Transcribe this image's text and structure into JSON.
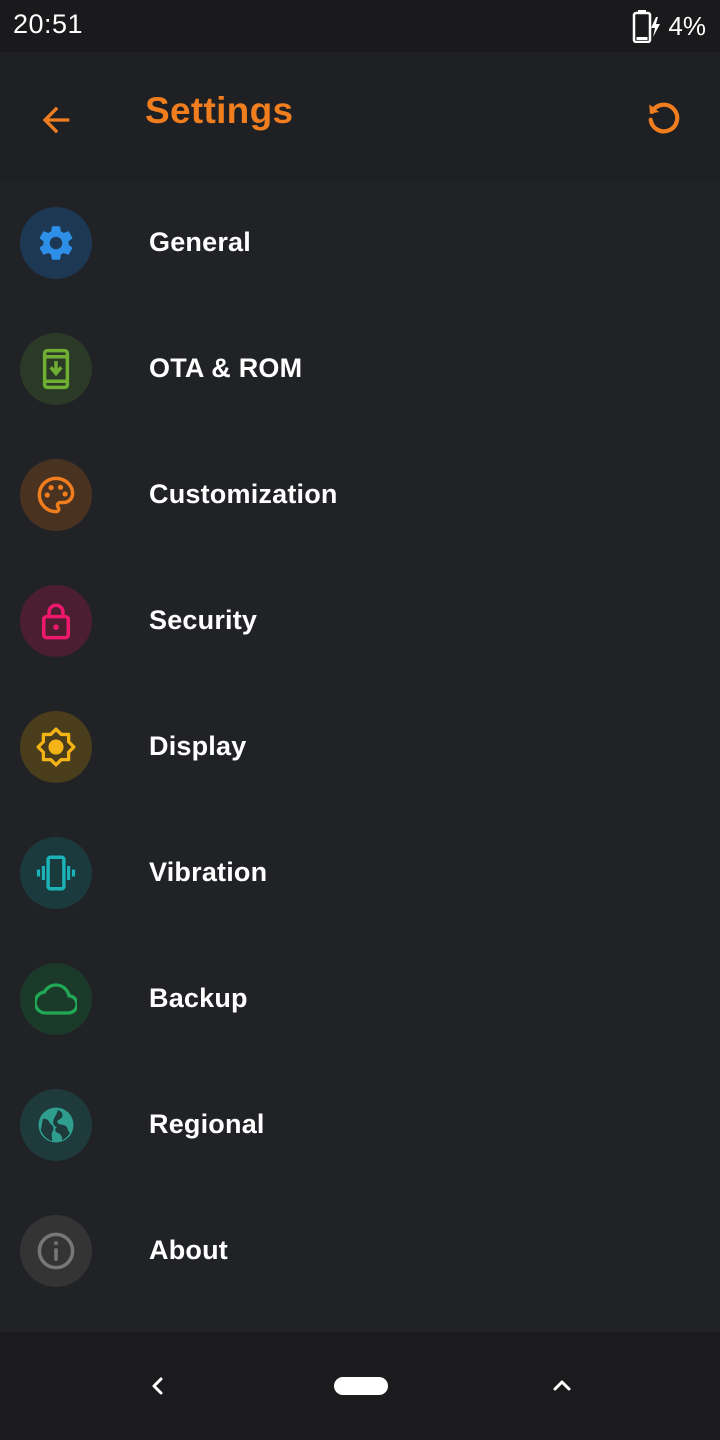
{
  "status_bar": {
    "time": "20:51",
    "battery": "4%",
    "battery_icon": "battery-charging-icon"
  },
  "app_bar": {
    "title": "Settings",
    "back_icon": "arrow-back-icon",
    "reset_icon": "restore-icon",
    "accent_color": "#f07d1e"
  },
  "settings": {
    "items": [
      {
        "label": "General",
        "icon": "gear-icon",
        "color": "#2d8fe8",
        "bg": "#1d3852"
      },
      {
        "label": "OTA & ROM",
        "icon": "system-update-icon",
        "color": "#6fae32",
        "bg": "#2b3a27"
      },
      {
        "label": "Customization",
        "icon": "palette-icon",
        "color": "#f07d1e",
        "bg": "#4a3221"
      },
      {
        "label": "Security",
        "icon": "lock-icon",
        "color": "#f0186c",
        "bg": "#4b1e30"
      },
      {
        "label": "Display",
        "icon": "brightness-icon",
        "color": "#f5b416",
        "bg": "#4a3d1c"
      },
      {
        "label": "Vibration",
        "icon": "vibration-icon",
        "color": "#1bb2b5",
        "bg": "#1b3a3e"
      },
      {
        "label": "Backup",
        "icon": "cloud-icon",
        "color": "#20a855",
        "bg": "#1c3a2a"
      },
      {
        "label": "Regional",
        "icon": "globe-icon",
        "color": "#2f9e8f",
        "bg": "#1e3a3a"
      },
      {
        "label": "About",
        "icon": "info-icon",
        "color": "#777777",
        "bg": "#343434"
      }
    ]
  },
  "nav_bar": {
    "back_icon": "nav-back-icon",
    "home_icon": "home-pill-icon",
    "recents_icon": "chevron-up-icon"
  }
}
